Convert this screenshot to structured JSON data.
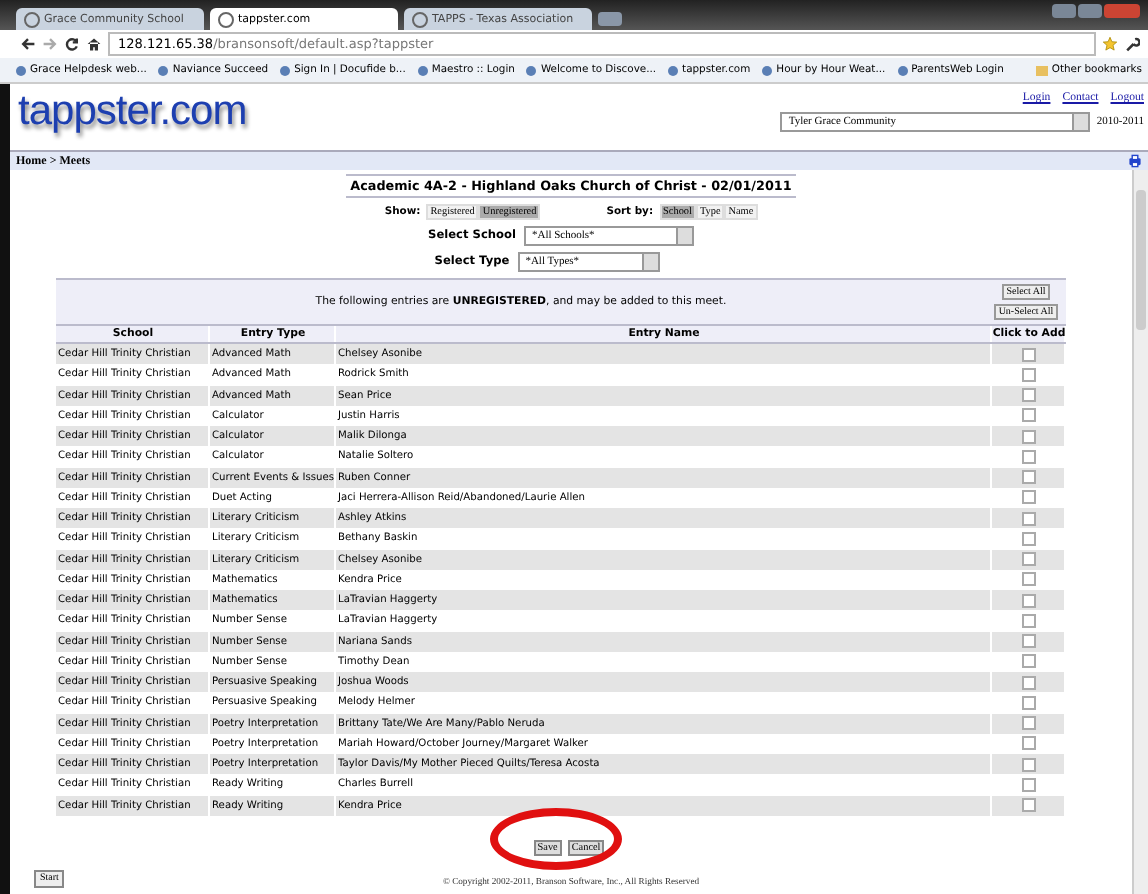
{
  "browser": {
    "tabs": [
      {
        "label": "Grace Community School",
        "selected": false
      },
      {
        "label": "tappster.com",
        "selected": true
      },
      {
        "label": "TAPPS - Texas Association",
        "selected": false
      }
    ],
    "url_host": "128.121.65.38",
    "url_path": "/bransonsoft/default.asp?tappster",
    "bookmarks": [
      "Grace Helpdesk web...",
      "Naviance Succeed",
      "Sign In | Docufide b...",
      "Maestro :: Login",
      "Welcome to Discove...",
      "tappster.com",
      "Hour by Hour Weat...",
      "ParentsWeb Login"
    ],
    "other_bookmarks": "Other bookmarks"
  },
  "header": {
    "logo": "tappster.com",
    "links": [
      "Login",
      "Contact",
      "Logout"
    ],
    "school_select": "Tyler Grace Community",
    "year": "2010-2011"
  },
  "breadcrumb": "Home > Meets",
  "meet_title": "Academic 4A-2 - Highland Oaks Church of Christ - 02/01/2011",
  "show": {
    "label": "Show:",
    "options": [
      {
        "label": "Registered",
        "selected": false
      },
      {
        "label": "Unregistered",
        "selected": true
      }
    ]
  },
  "sort": {
    "label": "Sort by:",
    "options": [
      {
        "label": "School",
        "selected": true
      },
      {
        "label": "Type",
        "selected": false
      },
      {
        "label": "Name",
        "selected": false
      }
    ]
  },
  "filters": [
    {
      "label": "Select School",
      "value": "*All Schools*"
    },
    {
      "label": "Select Type",
      "value": "*All Types*"
    }
  ],
  "message": "The following entries are **UNREGISTERED**, and may be added to this meet.",
  "select_all": "Select All",
  "unselect_all": "Un-Select All",
  "columns": [
    "School",
    "Entry Type",
    "Entry Name",
    "Click to Add"
  ],
  "rows": [
    {
      "school": "Cedar Hill Trinity Christian",
      "type": "Advanced Math",
      "name": "Chelsey Asonibe",
      "checked": false
    },
    {
      "school": "Cedar Hill Trinity Christian",
      "type": "Advanced Math",
      "name": "Rodrick Smith",
      "checked": false
    },
    {
      "school": "Cedar Hill Trinity Christian",
      "type": "Advanced Math",
      "name": "Sean Price",
      "checked": false
    },
    {
      "school": "Cedar Hill Trinity Christian",
      "type": "Calculator",
      "name": "Justin Harris",
      "checked": false
    },
    {
      "school": "Cedar Hill Trinity Christian",
      "type": "Calculator",
      "name": "Malik Dilonga",
      "checked": false
    },
    {
      "school": "Cedar Hill Trinity Christian",
      "type": "Calculator",
      "name": "Natalie Soltero",
      "checked": false
    },
    {
      "school": "Cedar Hill Trinity Christian",
      "type": "Current Events & Issues",
      "name": "Ruben Conner",
      "checked": false
    },
    {
      "school": "Cedar Hill Trinity Christian",
      "type": "Duet Acting",
      "name": "Jaci Herrera-Allison Reid/Abandoned/Laurie Allen",
      "checked": false
    },
    {
      "school": "Cedar Hill Trinity Christian",
      "type": "Literary Criticism",
      "name": "Ashley Atkins",
      "checked": false
    },
    {
      "school": "Cedar Hill Trinity Christian",
      "type": "Literary Criticism",
      "name": "Bethany Baskin",
      "checked": false
    },
    {
      "school": "Cedar Hill Trinity Christian",
      "type": "Literary Criticism",
      "name": "Chelsey Asonibe",
      "checked": false
    },
    {
      "school": "Cedar Hill Trinity Christian",
      "type": "Mathematics",
      "name": "Kendra Price",
      "checked": false
    },
    {
      "school": "Cedar Hill Trinity Christian",
      "type": "Mathematics",
      "name": "LaTravian Haggerty",
      "checked": false
    },
    {
      "school": "Cedar Hill Trinity Christian",
      "type": "Number Sense",
      "name": "LaTravian Haggerty",
      "checked": false
    },
    {
      "school": "Cedar Hill Trinity Christian",
      "type": "Number Sense",
      "name": "Nariana Sands",
      "checked": false
    },
    {
      "school": "Cedar Hill Trinity Christian",
      "type": "Number Sense",
      "name": "Timothy Dean",
      "checked": false
    },
    {
      "school": "Cedar Hill Trinity Christian",
      "type": "Persuasive Speaking",
      "name": "Joshua Woods",
      "checked": false
    },
    {
      "school": "Cedar Hill Trinity Christian",
      "type": "Persuasive Speaking",
      "name": "Melody Helmer",
      "checked": false
    },
    {
      "school": "Cedar Hill Trinity Christian",
      "type": "Poetry Interpretation",
      "name": "Brittany Tate/We Are Many/Pablo Neruda",
      "checked": false
    },
    {
      "school": "Cedar Hill Trinity Christian",
      "type": "Poetry Interpretation",
      "name": "Mariah Howard/October Journey/Margaret Walker",
      "checked": false
    },
    {
      "school": "Cedar Hill Trinity Christian",
      "type": "Poetry Interpretation",
      "name": "Taylor Davis/My Mother Pieced Quilts/Teresa Acosta",
      "checked": false
    },
    {
      "school": "Cedar Hill Trinity Christian",
      "type": "Ready Writing",
      "name": "Charles Burrell",
      "checked": false
    },
    {
      "school": "Cedar Hill Trinity Christian",
      "type": "Ready Writing",
      "name": "Kendra Price",
      "checked": false
    }
  ],
  "buttons": [
    "Save",
    "Cancel"
  ],
  "tooltip": "Start",
  "copyright": "© Copyright 2002-2011, Branson Software, Inc., All Rights Reserved"
}
